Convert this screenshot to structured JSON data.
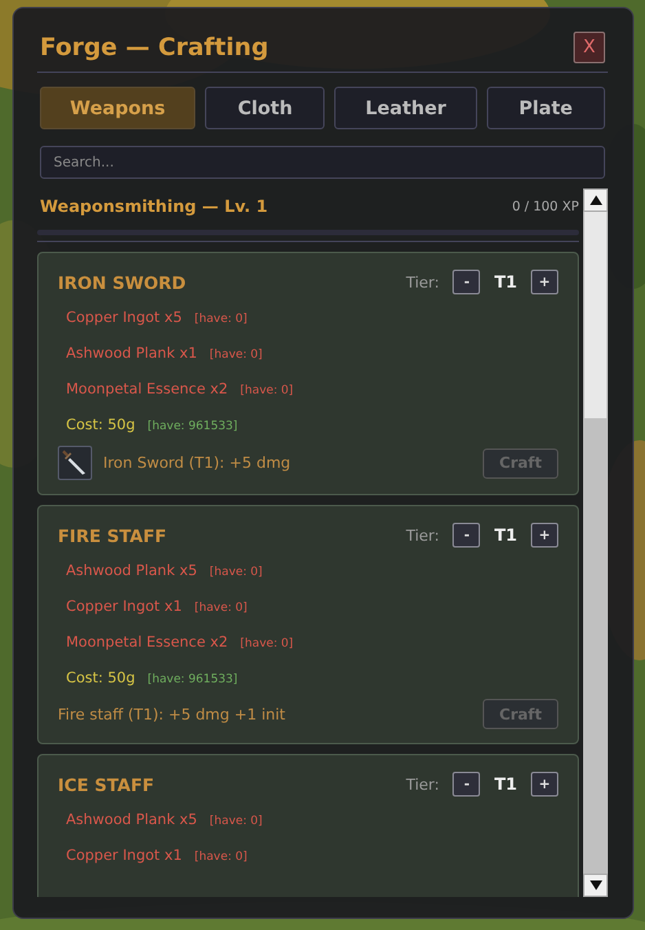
{
  "window": {
    "title": "Forge — Crafting",
    "close": "X"
  },
  "tabs": [
    {
      "label": "Weapons",
      "selected": true
    },
    {
      "label": "Cloth",
      "selected": false
    },
    {
      "label": "Leather",
      "selected": false
    },
    {
      "label": "Plate",
      "selected": false
    }
  ],
  "search": {
    "placeholder": "Search..."
  },
  "skill": {
    "title": "Weaponsmithing — Lv. 1",
    "xp": "0 / 100 XP",
    "level": 0
  },
  "recipes": [
    {
      "name": "IRON SWORD",
      "tier_label": "Tier:",
      "minus": "-",
      "tier": "T1",
      "plus": "+",
      "lines": [
        {
          "kind": "material",
          "text": "Copper Ingot x5",
          "have": "[have: 0]"
        },
        {
          "kind": "material",
          "text": "Ashwood Plank x1",
          "have": "[have: 0]"
        },
        {
          "kind": "material",
          "text": "Moonpetal Essence x2",
          "have": "[have: 0]"
        },
        {
          "kind": "cost",
          "text": "Cost: 50g",
          "have": "[have: 961533]"
        }
      ],
      "result": {
        "kind": "icon",
        "text": "Iron Sword (T1): +5 dmg"
      },
      "craft": {
        "label": "Craft",
        "disabled": true
      }
    },
    {
      "name": "FIRE STAFF",
      "tier_label": "Tier:",
      "minus": "-",
      "tier": "T1",
      "plus": "+",
      "lines": [
        {
          "kind": "material",
          "text": "Ashwood Plank x5",
          "have": "[have: 0]"
        },
        {
          "kind": "material",
          "text": "Copper Ingot x1",
          "have": "[have: 0]"
        },
        {
          "kind": "material",
          "text": "Moonpetal Essence x2",
          "have": "[have: 0]"
        },
        {
          "kind": "cost",
          "text": "Cost: 50g",
          "have": "[have: 961533]"
        }
      ],
      "result": {
        "kind": "text",
        "text": "Fire staff (T1): +5 dmg +1 init"
      },
      "craft": {
        "label": "Craft",
        "disabled": true
      }
    },
    {
      "name": "ICE STAFF",
      "tier_label": "Tier:",
      "minus": "-",
      "tier": "T1",
      "plus": "+",
      "lines": [
        {
          "kind": "material",
          "text": "Ashwood Plank x5",
          "have": "[have: 0]"
        },
        {
          "kind": "material",
          "text": "Copper Ingot x1",
          "have": "[have: 0]"
        }
      ]
    }
  ]
}
